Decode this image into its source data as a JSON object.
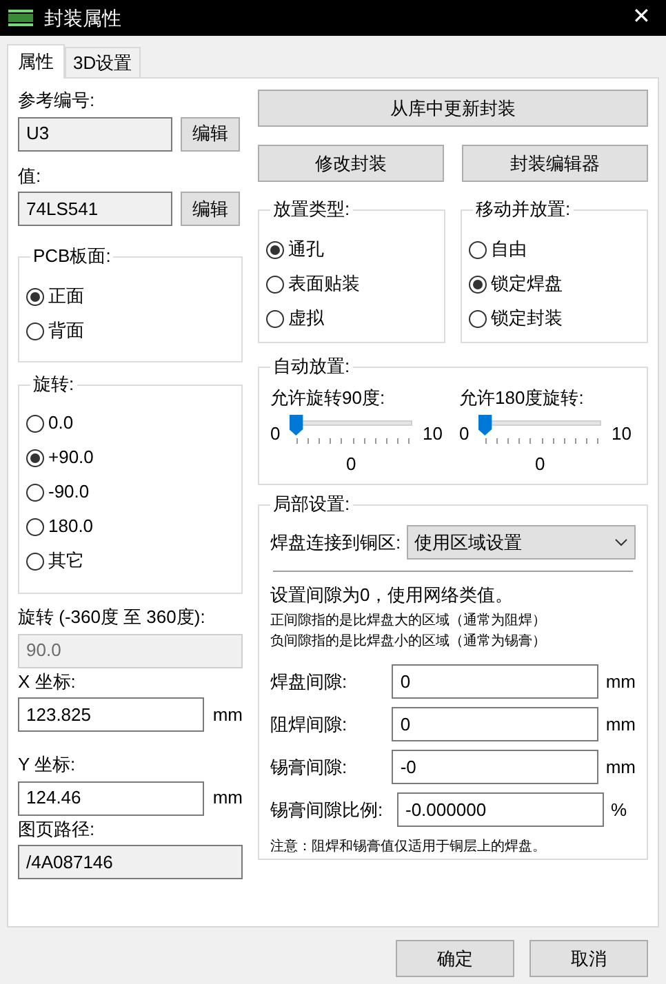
{
  "window": {
    "title": "封装属性",
    "close": "✕"
  },
  "tabs": [
    {
      "label": "属性",
      "selected": true
    },
    {
      "label": "3D设置",
      "selected": false
    }
  ],
  "reference": {
    "label": "参考编号:",
    "value": "U3",
    "button": "编辑"
  },
  "value": {
    "label": "值:",
    "value": "74LS541",
    "button": "编辑"
  },
  "pcb_side": {
    "title": "PCB板面:",
    "options": [
      {
        "label": "正面",
        "selected": true
      },
      {
        "label": "背面",
        "selected": false
      }
    ]
  },
  "rotation": {
    "title": "旋转:",
    "options": [
      {
        "label": "0.0",
        "selected": false
      },
      {
        "label": "+90.0",
        "selected": true
      },
      {
        "label": "-90.0",
        "selected": false
      },
      {
        "label": "180.0",
        "selected": false
      },
      {
        "label": "其它",
        "selected": false
      }
    ]
  },
  "rotation_custom": {
    "label": "旋转 (-360度 至 360度):",
    "value": "90.0",
    "disabled": true
  },
  "x_coord": {
    "label": "X 坐标:",
    "value": "123.825",
    "unit": "mm"
  },
  "y_coord": {
    "label": "Y 坐标:",
    "value": "124.46",
    "unit": "mm"
  },
  "sheet_path": {
    "label": "图页路径:",
    "value": "/4A087146"
  },
  "update_button": "从库中更新封装",
  "change_button": "修改封装",
  "editor_button": "封装编辑器",
  "placement_type": {
    "title": "放置类型:",
    "options": [
      {
        "label": "通孔",
        "selected": true
      },
      {
        "label": "表面贴装",
        "selected": false
      },
      {
        "label": "虚拟",
        "selected": false
      }
    ]
  },
  "move_place": {
    "title": "移动并放置:",
    "options": [
      {
        "label": "自由",
        "selected": false
      },
      {
        "label": "锁定焊盘",
        "selected": true
      },
      {
        "label": "锁定封装",
        "selected": false
      }
    ]
  },
  "auto_place": {
    "title": "自动放置:",
    "sliders": [
      {
        "label": "允许旋转90度:",
        "min": "0",
        "max": "10",
        "reading": "0",
        "level": 0
      },
      {
        "label": "允许180度旋转:",
        "min": "0",
        "max": "10",
        "reading": "0",
        "level": 0
      }
    ]
  },
  "local": {
    "title": "局部设置:",
    "pad_connection": {
      "label": "焊盘连接到铜区:",
      "value": "使用区域设置"
    },
    "note": "设置间隙为0，使用网络类值。",
    "hints": [
      "正间隙指的是比焊盘大的区域（通常为阻焊）",
      "负间隙指的是比焊盘小的区域（通常为锡膏）"
    ],
    "fields": [
      {
        "label": "焊盘间隙:",
        "value": "0",
        "unit": "mm"
      },
      {
        "label": "阻焊间隙:",
        "value": "0",
        "unit": "mm"
      },
      {
        "label": "锡膏间隙:",
        "value": "-0",
        "unit": "mm"
      },
      {
        "label": "锡膏间隙比例:",
        "value": "-0.000000",
        "unit": "%"
      }
    ],
    "footnote": "注意：阻焊和锡膏值仅适用于铜层上的焊盘。"
  },
  "buttons": [
    "确定",
    "取消"
  ]
}
